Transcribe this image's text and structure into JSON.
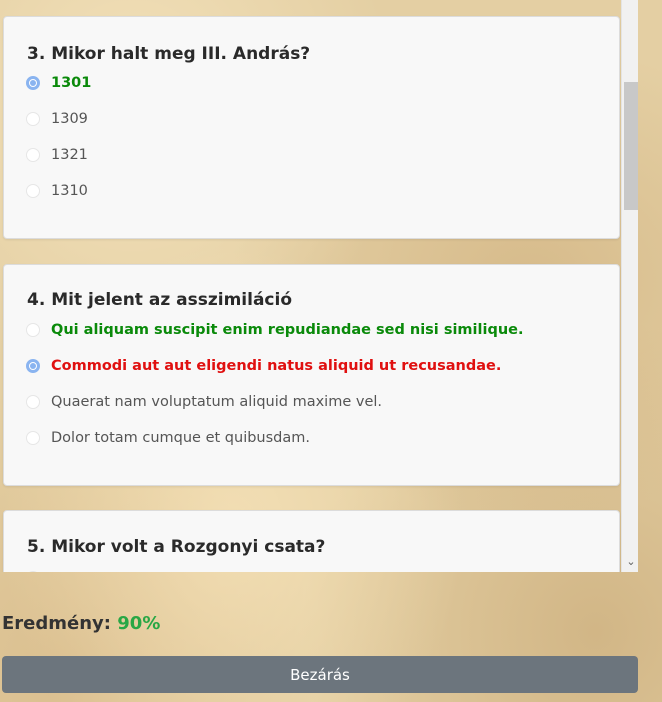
{
  "questions": [
    {
      "title": "3. Mikor halt meg III. András?",
      "options": [
        {
          "label": "1301",
          "state": "correct",
          "checked": true
        },
        {
          "label": "1309",
          "state": "none",
          "checked": false
        },
        {
          "label": "1321",
          "state": "none",
          "checked": false
        },
        {
          "label": "1310",
          "state": "none",
          "checked": false
        }
      ]
    },
    {
      "title": "4. Mit jelent az asszimiláció",
      "options": [
        {
          "label": "Qui aliquam suscipit enim repudiandae sed nisi similique.",
          "state": "correct",
          "checked": false
        },
        {
          "label": "Commodi aut aut eligendi natus aliquid ut recusandae.",
          "state": "wrong",
          "checked": true
        },
        {
          "label": "Quaerat nam voluptatum aliquid maxime vel.",
          "state": "none",
          "checked": false
        },
        {
          "label": "Dolor totam cumque et quibusdam.",
          "state": "none",
          "checked": false
        }
      ]
    },
    {
      "title": "5. Mikor volt a Rozgonyi csata?"
    }
  ],
  "result": {
    "label": "Eredmény:",
    "score": "90%"
  },
  "close_button": "Bezárás",
  "colors": {
    "correct": "#0a8a0a",
    "wrong": "#e01010",
    "score": "#28a745",
    "button": "#6c757d",
    "radio_checked": "#8ab4f0"
  }
}
